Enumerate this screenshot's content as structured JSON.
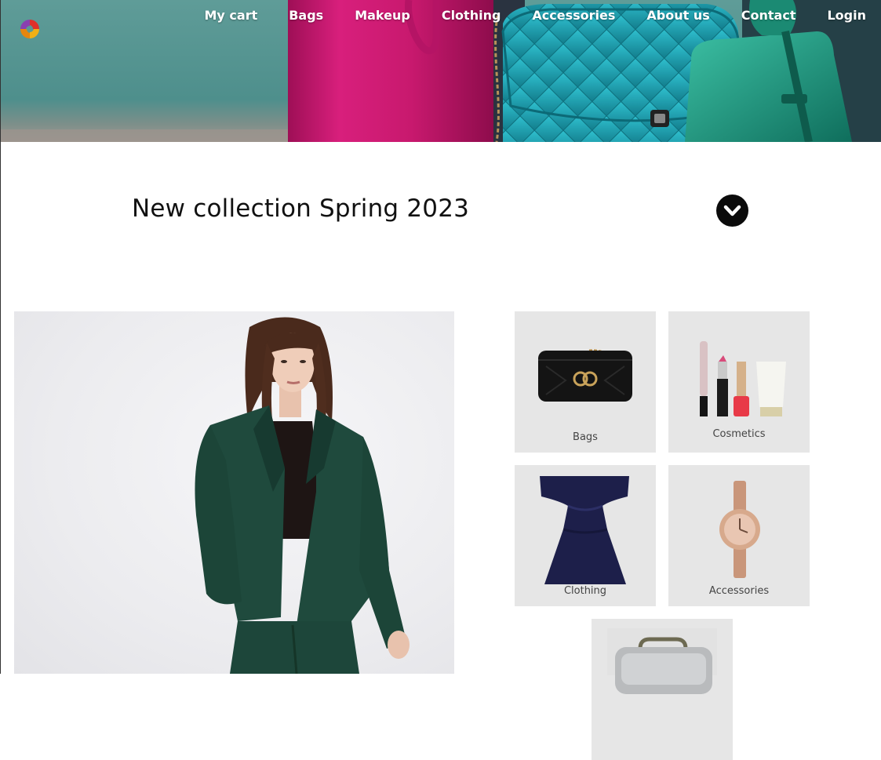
{
  "nav": {
    "items": [
      "My cart",
      "Bags",
      "Makeup",
      "Clothing",
      "Accessories",
      "About us",
      "Contact",
      "Login"
    ]
  },
  "headline": "New collection Spring 2023",
  "categories": [
    {
      "label": "Bags",
      "icon": "handbag-icon"
    },
    {
      "label": "Cosmetics",
      "icon": "cosmetics-icon"
    },
    {
      "label": "Clothing",
      "icon": "dress-icon"
    },
    {
      "label": "Accessories",
      "icon": "watch-icon"
    }
  ],
  "colors": {
    "hero_teal": "#5f9c98",
    "bag_magenta": "#c8196e",
    "bag_turquoise": "#1fa9b8",
    "bag_green": "#1f9a82",
    "tile_bg": "#e6e6e6",
    "chevron_button": "#0b0b0b"
  }
}
